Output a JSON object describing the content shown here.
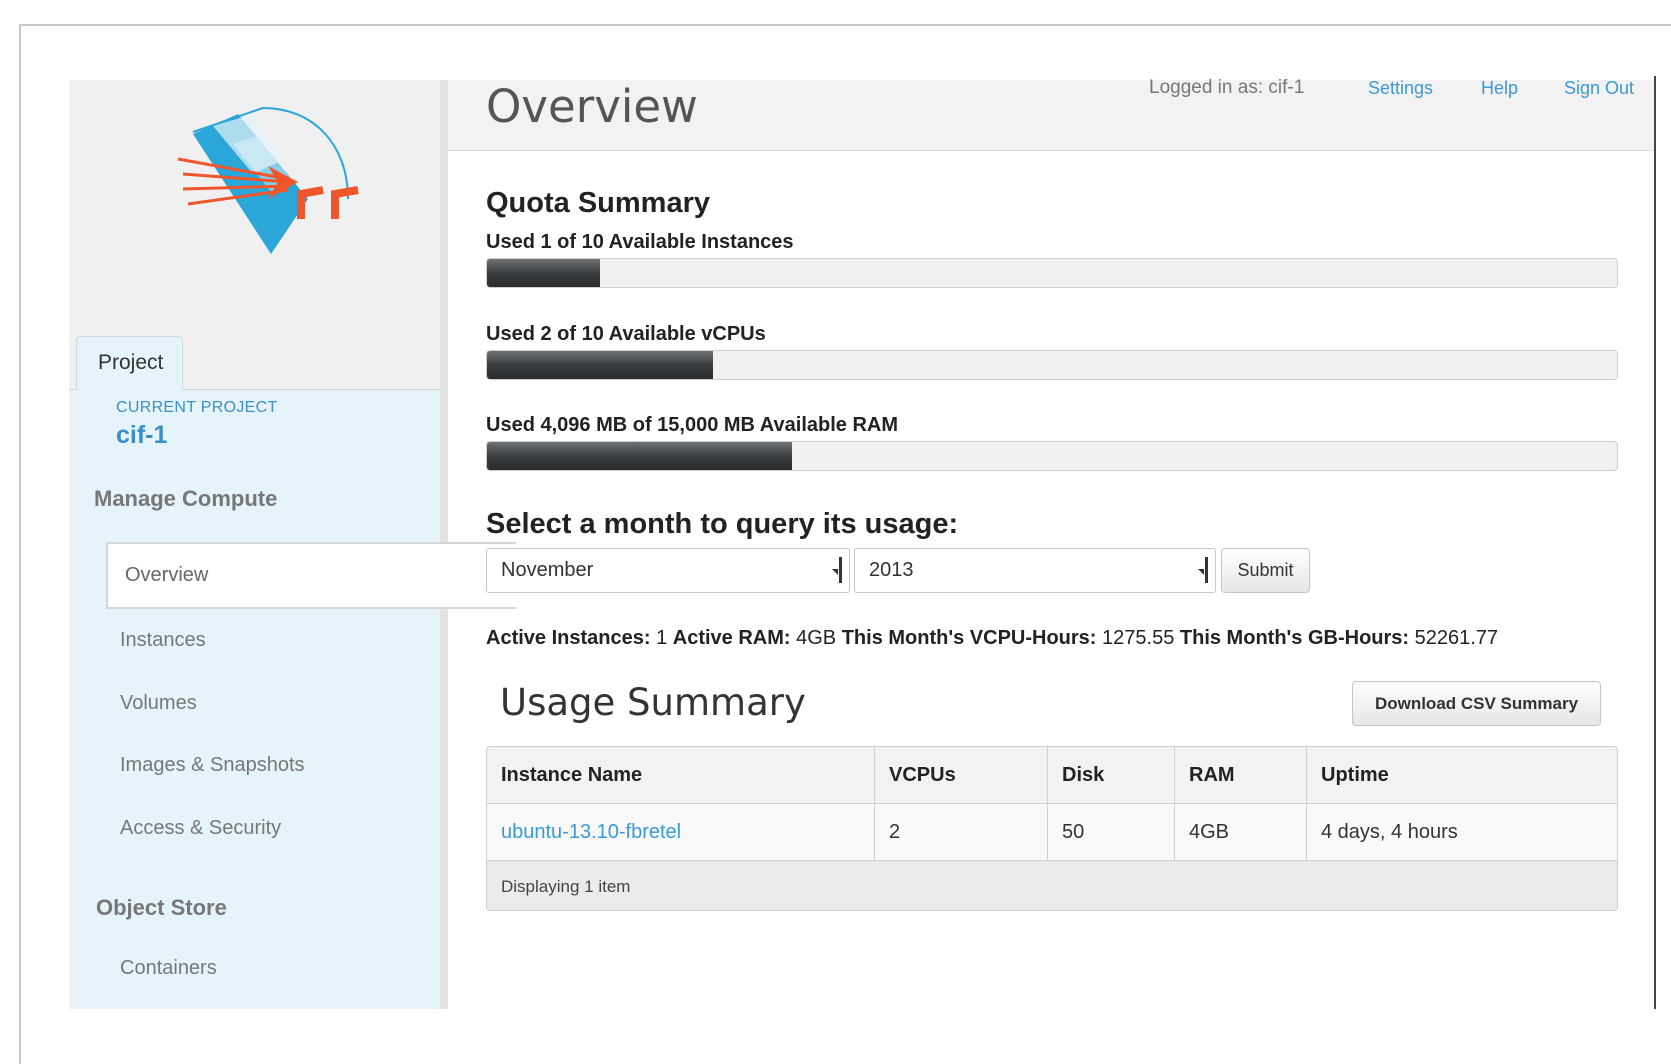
{
  "header": {
    "title": "Overview",
    "logged_in": "Logged in as: cif-1",
    "links": [
      "Settings",
      "Help",
      "Sign Out"
    ]
  },
  "sidebar": {
    "tab": "Project",
    "current_project_label": "CURRENT PROJECT",
    "current_project": "cif-1",
    "sections": [
      {
        "heading": "Manage Compute",
        "items": [
          "Overview",
          "Instances",
          "Volumes",
          "Images & Snapshots",
          "Access & Security"
        ]
      },
      {
        "heading": "Object Store",
        "items": [
          "Containers"
        ]
      }
    ],
    "active_item": "Overview"
  },
  "quota": {
    "title": "Quota Summary",
    "items": [
      {
        "label": "Used 1 of 10 Available Instances",
        "fraction": 0.1
      },
      {
        "label": "Used 2 of 10 Available vCPUs",
        "fraction": 0.2
      },
      {
        "label": "Used 4,096 MB of 15,000 MB Available RAM",
        "fraction": 0.27
      }
    ]
  },
  "query": {
    "title": "Select a month to query its usage:",
    "month": "November",
    "year": "2013",
    "submit": "Submit"
  },
  "stats": {
    "active_instances_label": "Active Instances:",
    "active_instances": "1",
    "active_ram_label": "Active RAM:",
    "active_ram": "4GB",
    "vcpu_hours_label": "This Month's VCPU-Hours:",
    "vcpu_hours": "1275.55",
    "gb_hours_label": "This Month's GB-Hours:",
    "gb_hours": "52261.77"
  },
  "usage": {
    "title": "Usage Summary",
    "download": "Download CSV Summary",
    "columns": [
      "Instance Name",
      "VCPUs",
      "Disk",
      "RAM",
      "Uptime"
    ],
    "rows": [
      [
        "ubuntu-13.10-fbretel",
        "2",
        "50",
        "4GB",
        "4 days, 4 hours"
      ]
    ],
    "footer": "Displaying 1 item"
  },
  "colors": {
    "accent": "#3a9ad9",
    "logo_orange": "#f0562b",
    "logo_blue": "#2aa6d8",
    "sidebar_panel": "#e5f3fa"
  }
}
